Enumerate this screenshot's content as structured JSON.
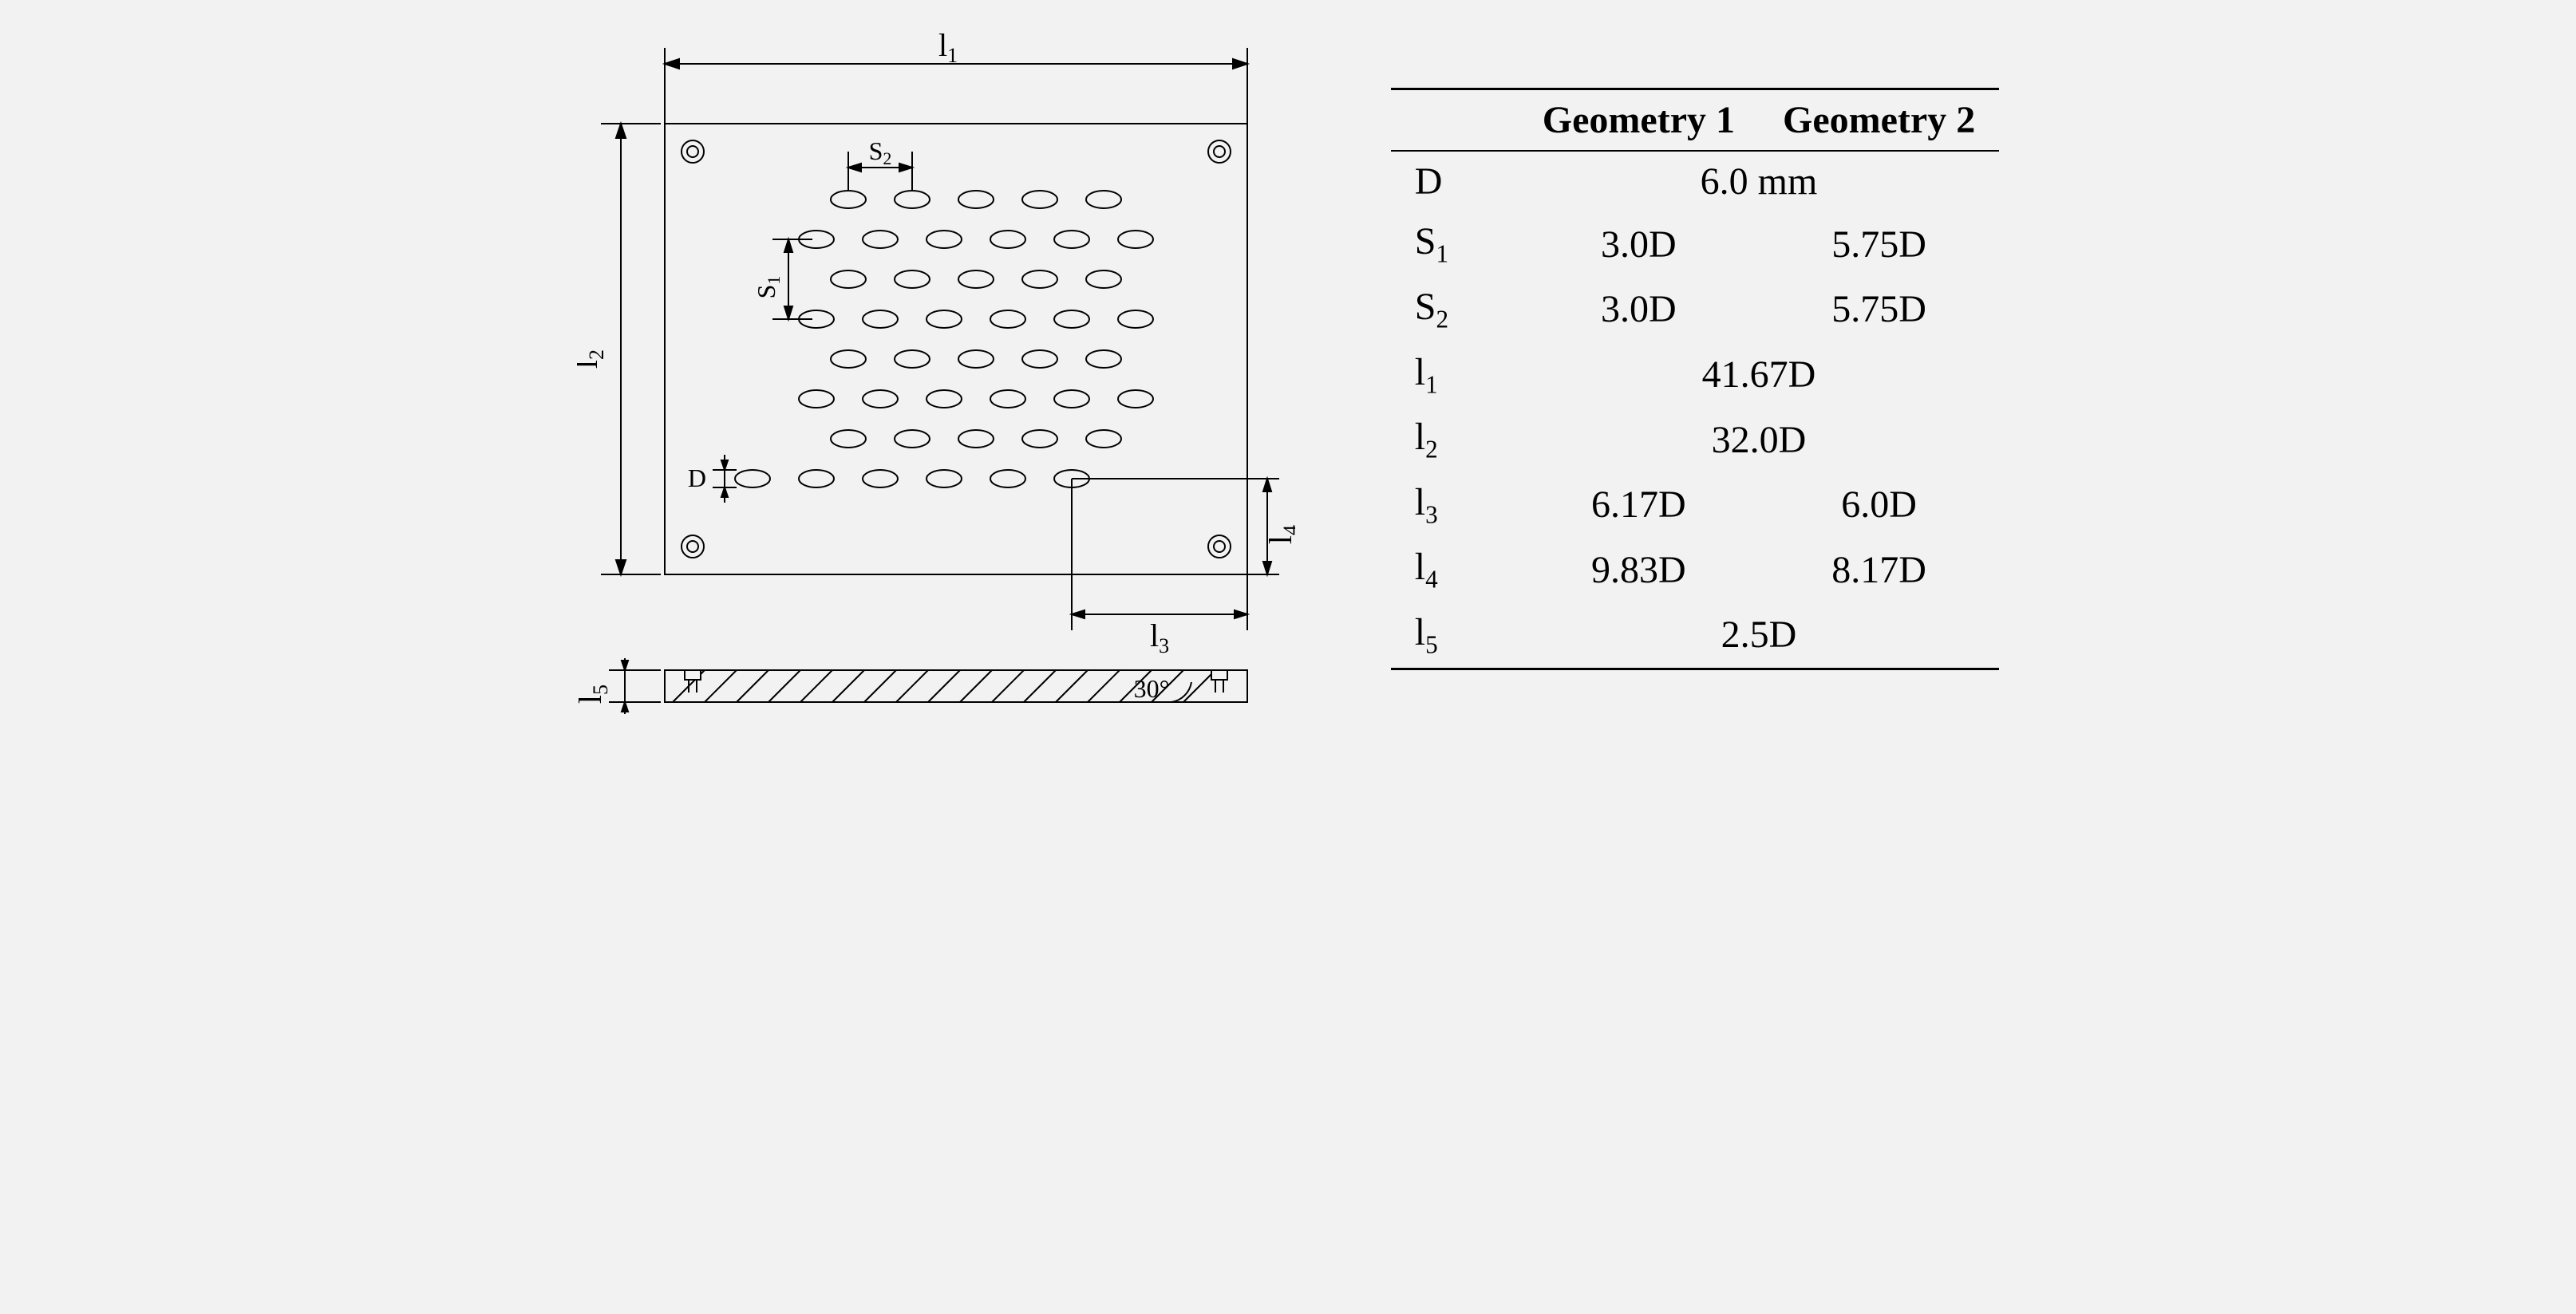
{
  "chart_data": {
    "type": "table",
    "parameters": [
      {
        "name": "D",
        "span": true,
        "value": "6.0 mm"
      },
      {
        "name": "S1",
        "g1": "3.0D",
        "g2": "5.75D"
      },
      {
        "name": "S2",
        "g1": "3.0D",
        "g2": "5.75D"
      },
      {
        "name": "l1",
        "span": true,
        "value": "41.67D"
      },
      {
        "name": "l2",
        "span": true,
        "value": "32.0D"
      },
      {
        "name": "l3",
        "g1": "6.17D",
        "g2": "6.0D"
      },
      {
        "name": "l4",
        "g1": "9.83D",
        "g2": "8.17D"
      },
      {
        "name": "l5",
        "span": true,
        "value": "2.5D"
      }
    ]
  },
  "headers": {
    "h1": "Geometry 1",
    "h2": "Geometry 2"
  },
  "rows": {
    "D": {
      "label": "D",
      "val": "6.0 mm"
    },
    "S1": {
      "label_main": "S",
      "label_sub": "1",
      "g1": "3.0D",
      "g2": "5.75D"
    },
    "S2": {
      "label_main": "S",
      "label_sub": "2",
      "g1": "3.0D",
      "g2": "5.75D"
    },
    "l1": {
      "label_main": "l",
      "label_sub": "1",
      "val": "41.67D"
    },
    "l2": {
      "label_main": "l",
      "label_sub": "2",
      "val": "32.0D"
    },
    "l3": {
      "label_main": "l",
      "label_sub": "3",
      "g1": "6.17D",
      "g2": "6.0D"
    },
    "l4": {
      "label_main": "l",
      "label_sub": "4",
      "g1": "9.83D",
      "g2": "8.17D"
    },
    "l5": {
      "label_main": "l",
      "label_sub": "5",
      "val": "2.5D"
    }
  },
  "dims": {
    "l1": "l",
    "l1s": "1",
    "l2": "l",
    "l2s": "2",
    "l3": "l",
    "l3s": "3",
    "l4": "l",
    "l4s": "4",
    "l5": "l",
    "l5s": "5",
    "S1": "S",
    "S1s": "1",
    "S2": "S",
    "S2s": "2",
    "D": "D",
    "angle": "30°"
  }
}
